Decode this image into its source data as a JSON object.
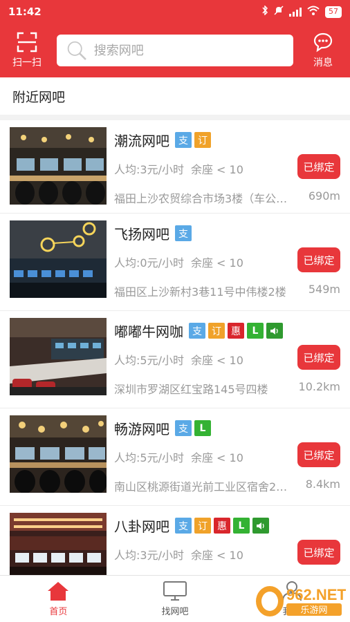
{
  "status": {
    "time": "11:42",
    "battery": "57"
  },
  "header": {
    "scan_label": "扫一扫",
    "search_placeholder": "搜索网吧",
    "msg_label": "消息"
  },
  "section_title": "附近网吧",
  "cafes": [
    {
      "name": "潮流网吧",
      "badges": [
        "支",
        "订"
      ],
      "price": "人均:3元/小时",
      "seats": "余座 < 10",
      "status": "已绑定",
      "address": "福田上沙农贸综合市场3楼（车公…",
      "distance": "690m"
    },
    {
      "name": "飞扬网吧",
      "badges": [
        "支"
      ],
      "price": "人均:0元/小时",
      "seats": "余座 < 10",
      "status": "已绑定",
      "address": "福田区上沙新村3巷11号中伟楼2楼",
      "distance": "549m"
    },
    {
      "name": "嘟嘟牛网咖",
      "badges": [
        "支",
        "订",
        "惠",
        "L",
        "sound"
      ],
      "price": "人均:5元/小时",
      "seats": "余座 < 10",
      "status": "已绑定",
      "address": "深圳市罗湖区红宝路145号四楼",
      "distance": "10.2km"
    },
    {
      "name": "畅游网吧",
      "badges": [
        "支",
        "L"
      ],
      "price": "人均:5元/小时",
      "seats": "余座 < 10",
      "status": "已绑定",
      "address": "南山区桃源街道光前工业区宿舍2…",
      "distance": "8.4km"
    },
    {
      "name": "八卦网吧",
      "badges": [
        "支",
        "订",
        "惠",
        "L",
        "sound"
      ],
      "price": "人均:3元/小时",
      "seats": "余座 < 10",
      "status": "已绑定",
      "address": "",
      "distance": ""
    }
  ],
  "tabs": {
    "home": "首页",
    "find": "找网吧",
    "mine": "我的"
  },
  "watermark": {
    "brand": "962.NET",
    "sub": "乐游网"
  },
  "colors": {
    "brand_red": "#e8373b",
    "zhi": "#5aa9e6",
    "ding": "#f0a22a",
    "hui": "#d9262c",
    "l": "#34b233"
  }
}
